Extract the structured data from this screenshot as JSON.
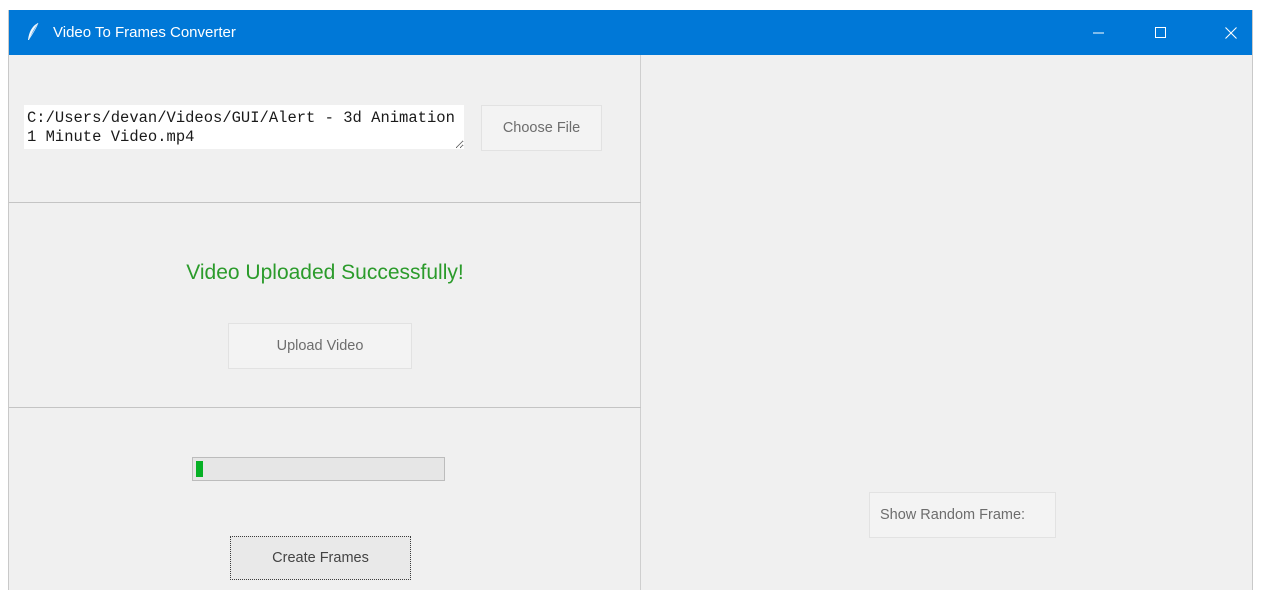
{
  "window": {
    "title": "Video To Frames Converter",
    "icons": {
      "app": "feather-icon",
      "minimize": "minimize-icon",
      "maximize": "maximize-icon",
      "close": "close-icon"
    }
  },
  "file_section": {
    "path_value": "C:/Users/devan/Videos/GUI/Alert - 3d Animation 1 Minute Video.mp4",
    "choose_label": "Choose File"
  },
  "upload_section": {
    "status": "Video Uploaded Successfully!",
    "upload_label": "Upload Video"
  },
  "frames_section": {
    "progress_percent": 3,
    "create_label": "Create Frames"
  },
  "preview_pane": {
    "random_label": "Show Random Frame:"
  },
  "colors": {
    "titlebar": "#0078d7",
    "status_text": "#2b9b2b",
    "progress_fill": "#06b025"
  }
}
